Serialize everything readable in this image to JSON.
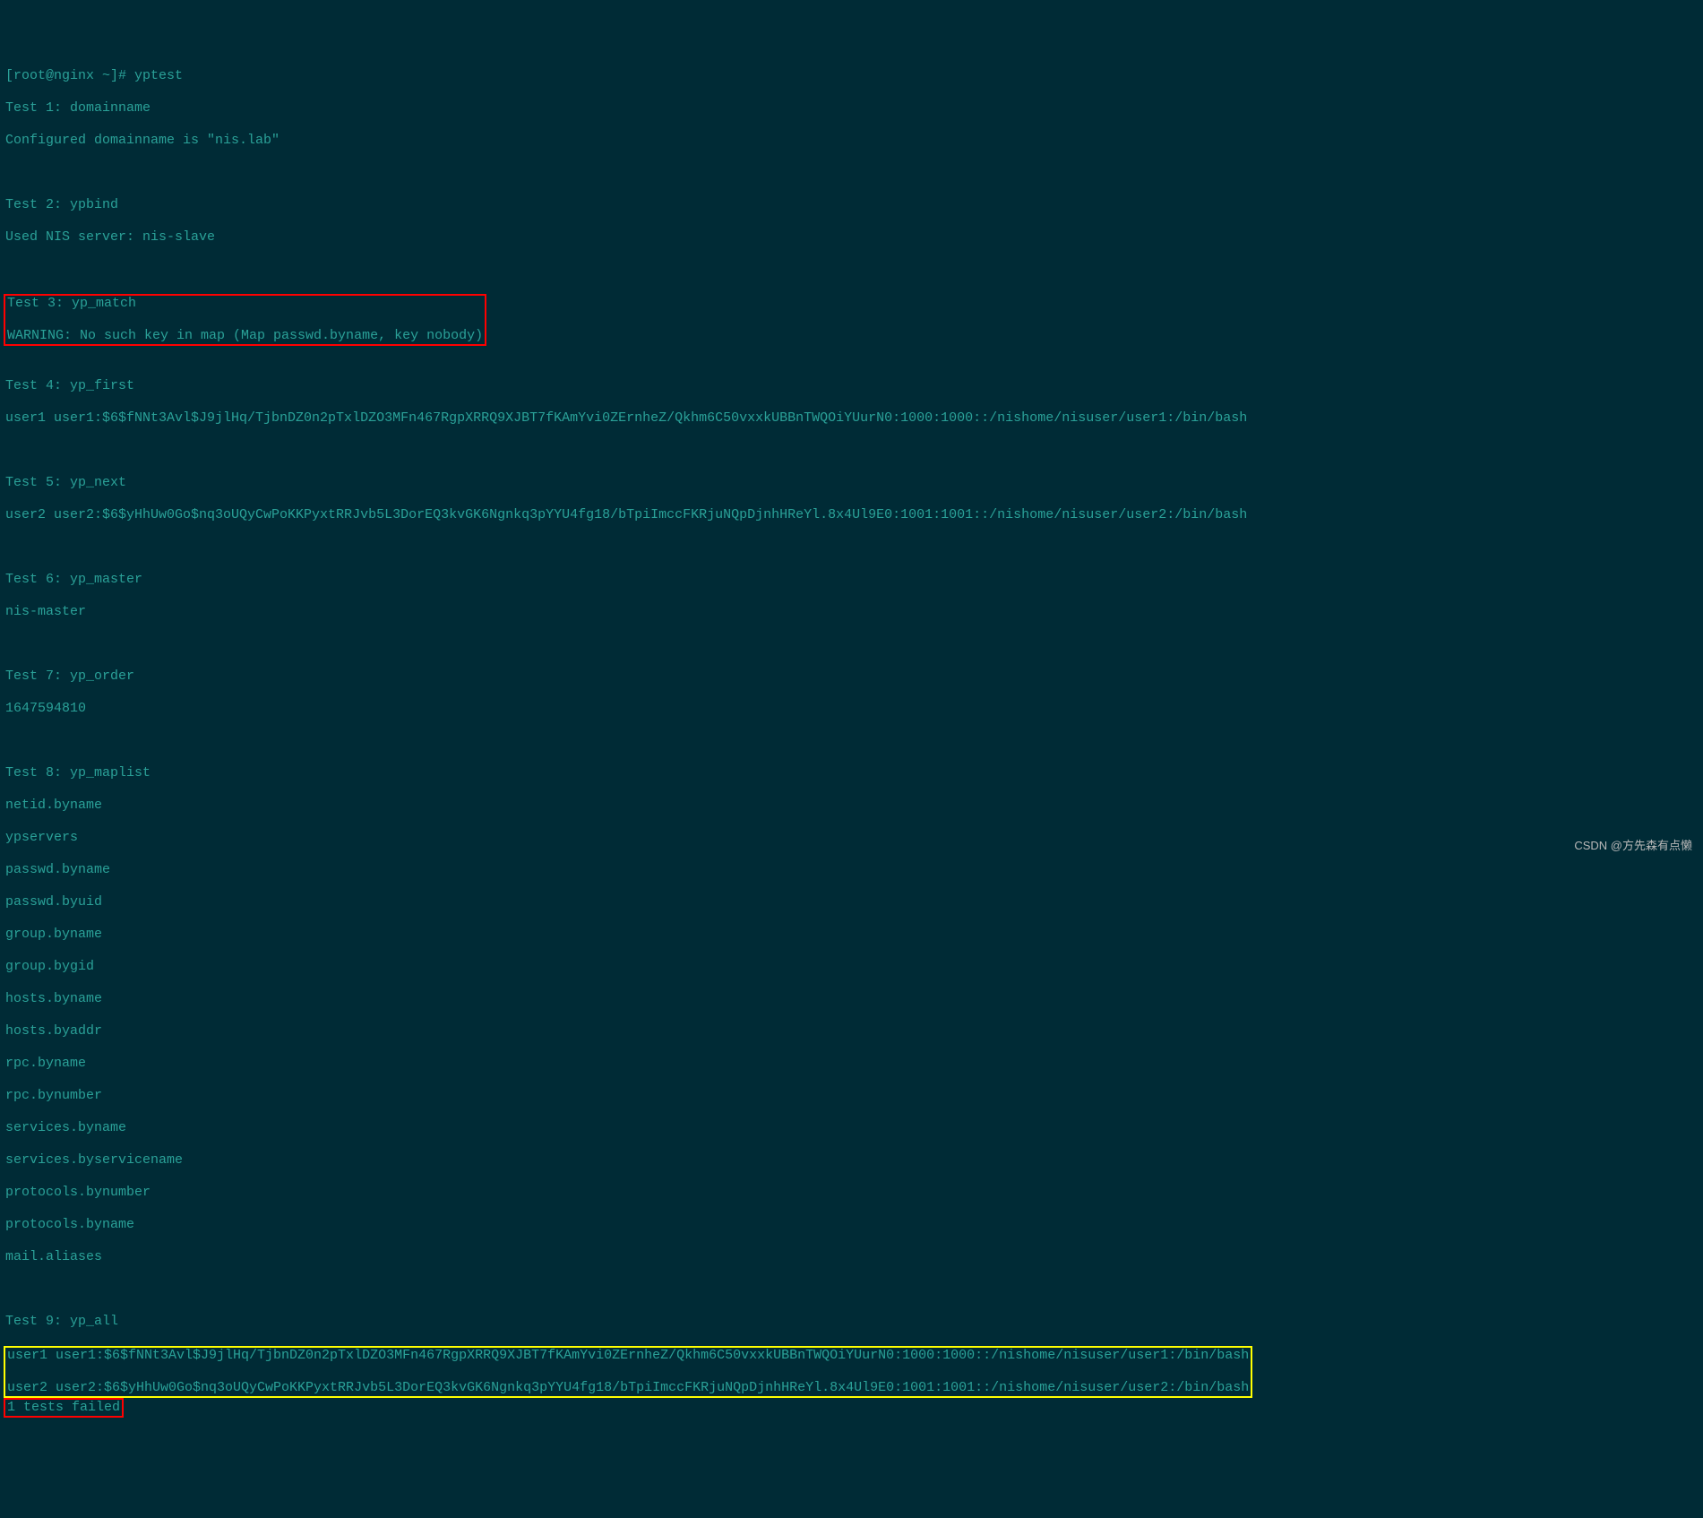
{
  "prompt": "[root@nginx ~]# yptest",
  "test1": {
    "header": "Test 1: domainname",
    "output": "Configured domainname is \"nis.lab\""
  },
  "test2": {
    "header": "Test 2: ypbind",
    "output": "Used NIS server: nis-slave"
  },
  "test3": {
    "header": "Test 3: yp_match",
    "output": "WARNING: No such key in map (Map passwd.byname, key nobody)"
  },
  "test4": {
    "header": "Test 4: yp_first",
    "output": "user1 user1:$6$fNNt3Avl$J9jlHq/TjbnDZ0n2pTxlDZO3MFn467RgpXRRQ9XJBT7fKAmYvi0ZErnheZ/Qkhm6C50vxxkUBBnTWQOiYUurN0:1000:1000::/nishome/nisuser/user1:/bin/bash"
  },
  "test5": {
    "header": "Test 5: yp_next",
    "output": "user2 user2:$6$yHhUw0Go$nq3oUQyCwPoKKPyxtRRJvb5L3DorEQ3kvGK6Ngnkq3pYYU4fg18/bTpiImccFKRjuNQpDjnhHReYl.8x4Ul9E0:1001:1001::/nishome/nisuser/user2:/bin/bash"
  },
  "test6": {
    "header": "Test 6: yp_master",
    "output": "nis-master"
  },
  "test7": {
    "header": "Test 7: yp_order",
    "output": "1647594810"
  },
  "test8": {
    "header": "Test 8: yp_maplist",
    "maps": [
      "netid.byname",
      "ypservers",
      "passwd.byname",
      "passwd.byuid",
      "group.byname",
      "group.bygid",
      "hosts.byname",
      "hosts.byaddr",
      "rpc.byname",
      "rpc.bynumber",
      "services.byname",
      "services.byservicename",
      "protocols.bynumber",
      "protocols.byname",
      "mail.aliases"
    ]
  },
  "test9": {
    "header": "Test 9: yp_all",
    "user1": "user1 user1:$6$fNNt3Avl$J9jlHq/TjbnDZ0n2pTxlDZO3MFn467RgpXRRQ9XJBT7fKAmYvi0ZErnheZ/Qkhm6C50vxxkUBBnTWQOiYUurN0:1000:1000::/nishome/nisuser/user1:/bin/bash",
    "user2": "user2 user2:$6$yHhUw0Go$nq3oUQyCwPoKKPyxtRRJvb5L3DorEQ3kvGK6Ngnkq3pYYU4fg18/bTpiImccFKRjuNQpDjnhHReYl.8x4Ul9E0:1001:1001::/nishome/nisuser/user2:/bin/bash"
  },
  "failed": "1 tests failed",
  "watermark": "CSDN @方先森有点懒"
}
